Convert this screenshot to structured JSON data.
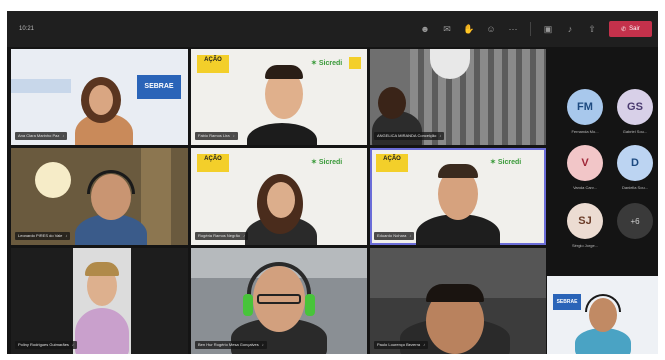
{
  "meeting": {
    "timer": "10:21",
    "leave_label": "Sair"
  },
  "toolbar": {
    "icons": [
      "people-icon",
      "chat-icon",
      "raise-hand-icon",
      "reactions-icon",
      "more-icon",
      "camera-icon",
      "mic-icon",
      "share-icon",
      "phone-icon"
    ]
  },
  "tiles": [
    {
      "name": "Ana Clara Marinho Paz"
    },
    {
      "name": "Fabio Ramos Lira"
    },
    {
      "name": "ANGELICA MIRANDA Conceição"
    },
    {
      "name": "Leonardo PIRES do Vale"
    },
    {
      "name": "Rogéria Ramos Negrão"
    },
    {
      "name": "Eduardo Nohara"
    },
    {
      "name": "Poliny Rodrigues Guimarães"
    },
    {
      "name": "Ben Hur Rogério Mesa Gonçalves"
    },
    {
      "name": "Paulo Lourenço Bezerra"
    }
  ],
  "participants": [
    {
      "initials": "FM",
      "label": "Fernanda Mo...",
      "bg": "#a8c8ec",
      "fg": "#1d4a80"
    },
    {
      "initials": "GS",
      "label": "Gabriel Sou...",
      "bg": "#d8d0e8",
      "fg": "#4a3a70"
    },
    {
      "initials": "V",
      "label": "Vanda Carv...",
      "bg": "#f2c6c8",
      "fg": "#a02638"
    },
    {
      "initials": "D",
      "label": "Daniella Sou...",
      "bg": "#bcd4f2",
      "fg": "#1d4a80"
    },
    {
      "initials": "SJ",
      "label": "Sérgio Jorge...",
      "bg": "#ecdcd2",
      "fg": "#6a3c28"
    },
    {
      "initials": "+6",
      "label": ""
    }
  ],
  "colors": {
    "leave": "#c4314b",
    "active_speaker": "#6b6dd8",
    "banner": "#f3cf2a",
    "sebrae": "#2a64b8"
  }
}
